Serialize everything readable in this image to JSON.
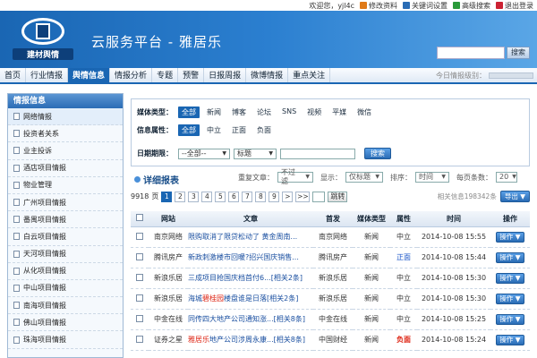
{
  "top": {
    "welcome": "欢迎您，yjl4c",
    "links": [
      {
        "label": "修改资料",
        "color": "#e07a18"
      },
      {
        "label": "关键词设置",
        "color": "#2a6cb5"
      },
      {
        "label": "高级搜索",
        "color": "#2a9a3a"
      },
      {
        "label": "退出登录",
        "color": "#c23"
      }
    ]
  },
  "banner": {
    "logo_text": "建材舆情",
    "title": "云服务平台 - 雅居乐",
    "search_button": "搜索"
  },
  "nav": {
    "items": [
      "首页",
      "行业情报",
      "舆情信息",
      "情报分析",
      "专题",
      "预警",
      "日报周报",
      "微博情报",
      "重点关注"
    ],
    "active": 2,
    "today_label": "今日情报级别："
  },
  "sidebar": {
    "title": "情报信息",
    "items": [
      "网络情报",
      "投资者关系",
      "业主投诉",
      "酒店项目情报",
      "物业管理",
      "广州项目情报",
      "番禺项目情报",
      "白云项目情报",
      "天河项目情报",
      "从化项目情报",
      "中山项目情报",
      "南海项目情报",
      "佛山项目情报",
      "珠海项目情报"
    ]
  },
  "filter": {
    "media_label": "媒体类型：",
    "media_options": [
      "全部",
      "新闻",
      "博客",
      "论坛",
      "SNS",
      "视频",
      "平媒",
      "微信"
    ],
    "attr_label": "信息属性：",
    "attr_options": [
      "全部",
      "中立",
      "正面",
      "负面"
    ],
    "date_label": "日期期限：",
    "range_select": "--全部--",
    "field_select": "标题",
    "search_button": "搜索"
  },
  "detail": {
    "title": "详细报表",
    "repeat_label": "重复文章：",
    "repeat_value": "不过滤",
    "display_label": "显示：",
    "display_value": "仅标题",
    "sort_label": "排序：",
    "sort_value": "时间",
    "per_page_label": "每页条数：",
    "per_page_value": "20"
  },
  "pager": {
    "total_pages": "9918",
    "page_word": "页",
    "pages": [
      "1",
      "2",
      "3",
      "4",
      "5",
      "6",
      "7",
      "8",
      "9"
    ],
    "current": 0,
    "next": ">",
    "last": ">>",
    "jump": "跳转",
    "related": "相关信息198342条",
    "export": "导出"
  },
  "table": {
    "headers": [
      "网站",
      "文章",
      "首发",
      "媒体类型",
      "属性",
      "时间",
      "操作"
    ],
    "op_label": "操作",
    "rows": [
      {
        "site": "南京网络",
        "title": "限购取消了限贷松动了 黄金周南...",
        "hl": "",
        "rel": "",
        "first": "南京网络",
        "media": "新闻",
        "attr": "中立",
        "attr_cls": "attr-zl",
        "time": "2014-10-08 15:55"
      },
      {
        "site": "腾讯房产",
        "title": "新政刺激楼市回暖?招兴国庆销售...",
        "hl": "",
        "rel": "",
        "first": "腾讯房产",
        "media": "新闻",
        "attr": "正面",
        "attr_cls": "attr-zm",
        "time": "2014-10-08 15:44"
      },
      {
        "site": "新浪乐居",
        "title": "三成项目抢国庆档首付6...",
        "hl": "",
        "rel": "[相关2条]",
        "first": "新浪乐居",
        "media": "新闻",
        "attr": "中立",
        "attr_cls": "attr-zl",
        "time": "2014-10-08 15:30"
      },
      {
        "site": "新浪乐居",
        "title": "海城",
        "hl": "碧桂园",
        "tail": "楼盘谁是日落",
        "rel": "[相关2条]",
        "first": "新浪乐居",
        "media": "新闻",
        "attr": "中立",
        "attr_cls": "attr-zl",
        "time": "2014-10-08 15:30"
      },
      {
        "site": "中金在线",
        "title": "同传四大地产公司通知涨...",
        "hl": "",
        "rel": "[相关8条]",
        "first": "中金在线",
        "media": "新闻",
        "attr": "中立",
        "attr_cls": "attr-zl",
        "time": "2014-10-08 15:25"
      },
      {
        "site": "证券之星",
        "title": "",
        "hl": "雅居乐",
        "tail": "地产公司涉周永康...",
        "rel": "[相关8条]",
        "first": "中国财经",
        "media": "新闻",
        "attr": "负面",
        "attr_cls": "attr-fm",
        "time": "2014-10-08 15:24"
      }
    ]
  }
}
